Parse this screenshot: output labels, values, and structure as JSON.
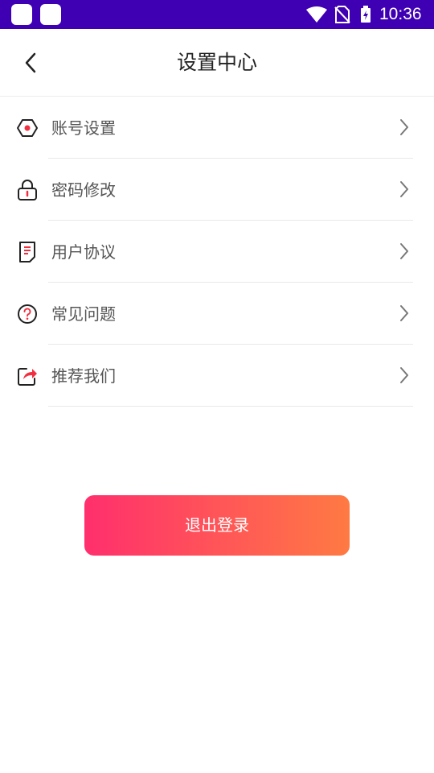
{
  "status_bar": {
    "time": "10:36",
    "background": "#3f00b4",
    "icons": [
      "notification-square",
      "notification-square",
      "wifi-icon",
      "no-sim-icon",
      "battery-charging-icon"
    ]
  },
  "header": {
    "back_icon": "chevron-left-icon",
    "title": "设置中心"
  },
  "menu": {
    "items": [
      {
        "label": "账号设置",
        "icon": "hexagon-dot-icon",
        "chevron": "chevron-right-icon"
      },
      {
        "label": "密码修改",
        "icon": "lock-icon",
        "chevron": "chevron-right-icon"
      },
      {
        "label": "用户协议",
        "icon": "document-icon",
        "chevron": "chevron-right-icon"
      },
      {
        "label": "常见问题",
        "icon": "question-circle-icon",
        "chevron": "chevron-right-icon"
      },
      {
        "label": "推荐我们",
        "icon": "share-icon",
        "chevron": "chevron-right-icon"
      }
    ]
  },
  "logout": {
    "label": "退出登录",
    "gradient_start": "#ff2f6d",
    "gradient_end": "#ff7a43"
  },
  "colors": {
    "icon_stroke": "#222222",
    "icon_accent": "#f03040",
    "label_text": "#555555",
    "divider": "#e8e8e8"
  }
}
